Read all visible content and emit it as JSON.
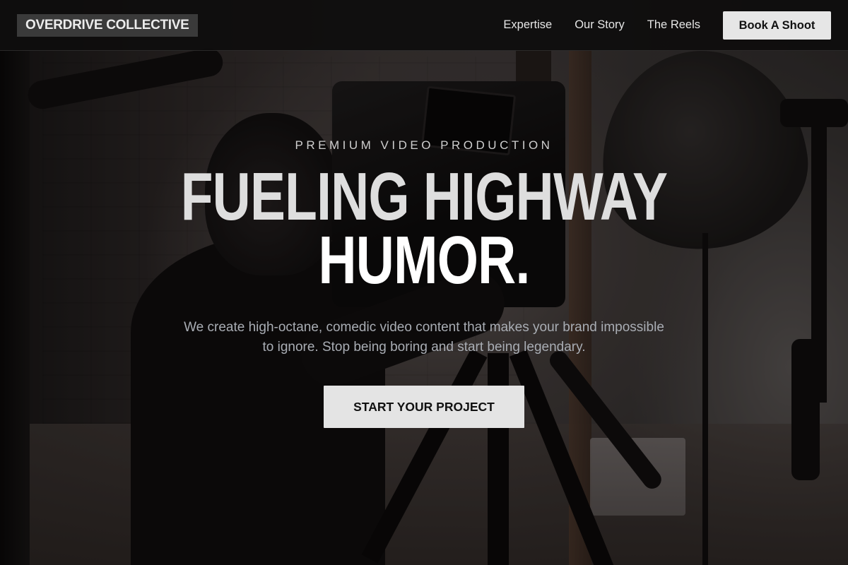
{
  "nav": {
    "logo": "OVERDRIVE COLLECTIVE",
    "links": [
      "Expertise",
      "Our Story",
      "The Reels"
    ],
    "cta_label": "Book A Shoot"
  },
  "hero": {
    "eyebrow": "PREMIUM VIDEO PRODUCTION",
    "headline_line1": "FUELING HIGHWAY",
    "headline_line2": "HUMOR.",
    "subtext": "We create high-octane, comedic video content that makes your brand impossible to ignore. Stop being boring and start being legendary.",
    "cta_label": "START YOUR PROJECT",
    "background_image": "videographer-with-camera-on-tripod-in-studio"
  },
  "colors": {
    "nav_bg": "#0e0d0d",
    "button_bg": "#e4e4e4",
    "button_text": "#111111",
    "headline": "#e5e5e5",
    "subtext": "#a9adb4"
  }
}
